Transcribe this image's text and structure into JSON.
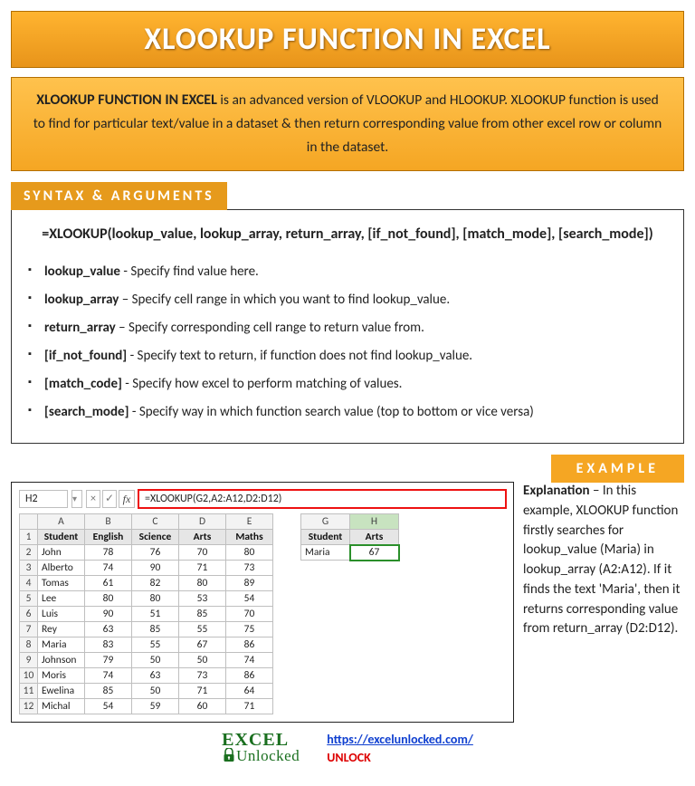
{
  "title": "XLOOKUP FUNCTION IN EXCEL",
  "intro": {
    "lead": "XLOOKUP FUNCTION IN EXCEL",
    "rest": " is an advanced version of VLOOKUP and HLOOKUP. XLOOKUP function is used to find for particular text/value in a dataset & then return corresponding value from other excel row or column in the dataset."
  },
  "section_syntax_label": "SYNTAX & ARGUMENTS",
  "syntax_formula": "=XLOOKUP(lookup_value, lookup_array, return_array, [if_not_found], [match_mode], [search_mode])",
  "arguments": [
    {
      "name": "lookup_value",
      "desc": " - Specify find value here."
    },
    {
      "name": "lookup_array",
      "desc": " – Specify cell range in which you want to find lookup_value."
    },
    {
      "name": "return_array",
      "desc": " – Specify corresponding cell range to return value from."
    },
    {
      "name": "[if_not_found]",
      "desc": " - Specify text to return, if function does not find lookup_value."
    },
    {
      "name": "[match_code]",
      "desc": " - Specify how excel to perform matching of values."
    },
    {
      "name": "[search_mode]",
      "desc": " - Specify way in which function search value (top to bottom or vice versa)"
    }
  ],
  "section_example_label": "EXAMPLE",
  "example": {
    "cell_ref": "H2",
    "formula": "=XLOOKUP(G2,A2:A12,D2:D12)",
    "explain_label": "Explanation",
    "explain_text": " – In this example, XLOOKUP function firstly searches for lookup_value (Maria) in lookup_array (A2:A12). If it finds the text 'Maria', then it returns corresponding value from return_array (D2:D12).",
    "main_table": {
      "cols": [
        "A",
        "B",
        "C",
        "D",
        "E"
      ],
      "headers": [
        "Student",
        "English",
        "Science",
        "Arts",
        "Maths"
      ],
      "rows": [
        [
          "John",
          "78",
          "76",
          "70",
          "80"
        ],
        [
          "Alberto",
          "74",
          "90",
          "71",
          "73"
        ],
        [
          "Tomas",
          "61",
          "82",
          "80",
          "89"
        ],
        [
          "Lee",
          "80",
          "80",
          "53",
          "54"
        ],
        [
          "Luis",
          "90",
          "51",
          "85",
          "70"
        ],
        [
          "Rey",
          "63",
          "85",
          "55",
          "75"
        ],
        [
          "Maria",
          "83",
          "55",
          "67",
          "86"
        ],
        [
          "Johnson",
          "79",
          "50",
          "50",
          "74"
        ],
        [
          "Moris",
          "74",
          "63",
          "73",
          "86"
        ],
        [
          "Ewelina",
          "85",
          "50",
          "71",
          "64"
        ],
        [
          "Michal",
          "54",
          "59",
          "60",
          "71"
        ]
      ]
    },
    "side_table": {
      "cols": [
        "G",
        "H"
      ],
      "headers": [
        "Student",
        "Arts"
      ],
      "row": [
        "Maria",
        "67"
      ]
    }
  },
  "footer": {
    "logo_top_a": "E",
    "logo_top_b": "CEL",
    "logo_x": "X",
    "logo_bottom": "Unlocked",
    "url_text": "https://excelunlocked.com/",
    "url_href": "https://excelunlocked.com/",
    "tagline": "UNLOCK"
  }
}
